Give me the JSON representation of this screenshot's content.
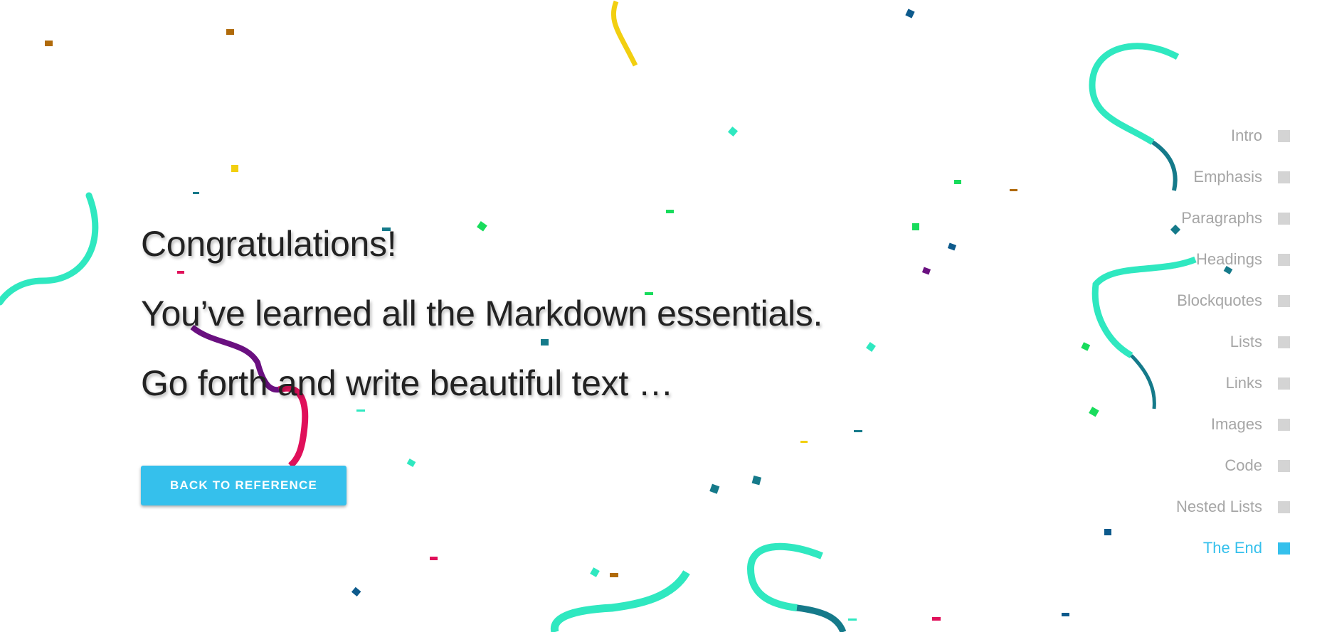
{
  "main": {
    "lines": [
      "Congratulations!",
      "You’ve learned all the Markdown essentials.",
      "Go forth and write beautiful text …"
    ],
    "back_button_label": "BACK TO REFERENCE"
  },
  "toc": {
    "items": [
      {
        "label": "Intro",
        "active": false
      },
      {
        "label": "Emphasis",
        "active": false
      },
      {
        "label": "Paragraphs",
        "active": false
      },
      {
        "label": "Headings",
        "active": false
      },
      {
        "label": "Blockquotes",
        "active": false
      },
      {
        "label": "Lists",
        "active": false
      },
      {
        "label": "Links",
        "active": false
      },
      {
        "label": "Images",
        "active": false
      },
      {
        "label": "Code",
        "active": false
      },
      {
        "label": "Nested Lists",
        "active": false
      },
      {
        "label": "The End",
        "active": true
      }
    ]
  },
  "colors": {
    "accent": "#35c0ec",
    "text": "#222222",
    "toc_inactive": "#a6a6a6",
    "toc_box_inactive": "#d4d4d4",
    "confetti": [
      "#2fe8c0",
      "#157a8a",
      "#f2cf10",
      "#0d5a8c",
      "#18dc5c",
      "#b06a0a",
      "#6a1080",
      "#e0105a"
    ]
  }
}
